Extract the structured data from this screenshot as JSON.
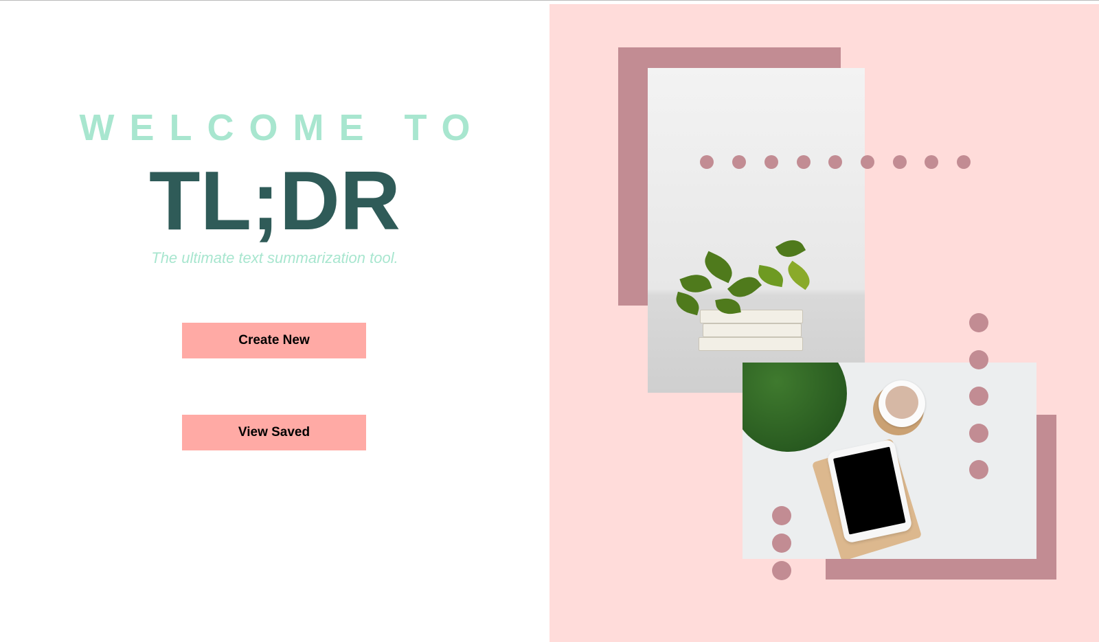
{
  "hero": {
    "welcome": "WELCOME TO",
    "title": "TL;DR",
    "tagline": "The ultimate text summarization tool."
  },
  "actions": {
    "create_label": "Create New",
    "view_label": "View Saved"
  },
  "colors": {
    "accent_mint": "#a8e6cf",
    "title_teal": "#2f5b58",
    "button_salmon": "#ffaaa5",
    "panel_pink": "#ffdcda",
    "decor_mauve": "#c28c93"
  },
  "decor": {
    "photo_1": "plant-and-books-photo",
    "photo_2": "desk-flatlay-photo"
  }
}
